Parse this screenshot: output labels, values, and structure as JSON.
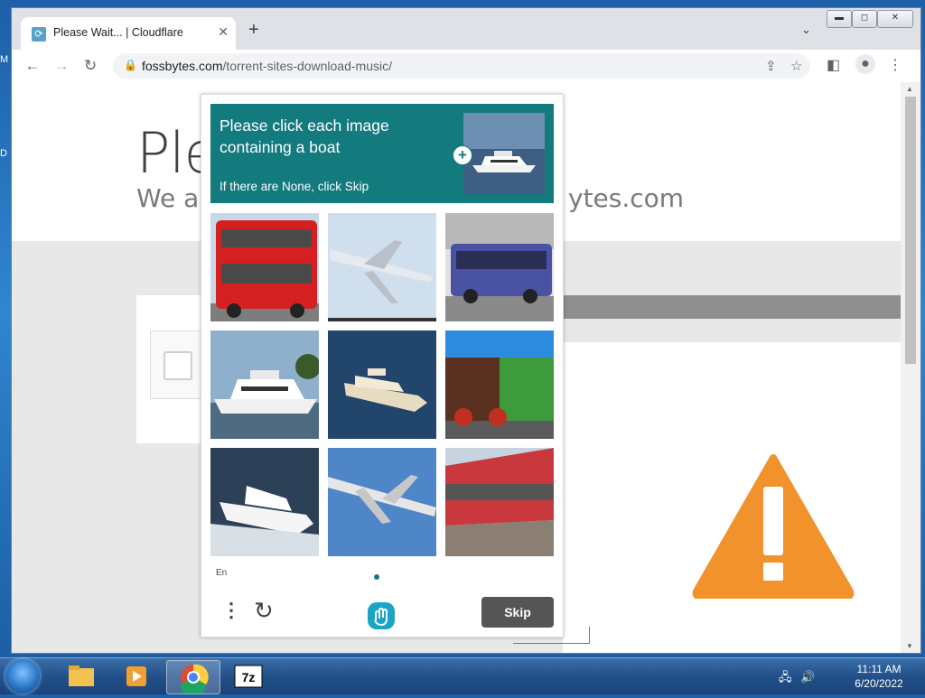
{
  "browser": {
    "tab_title": "Please Wait... | Cloudflare",
    "url_host": "fossbytes.com",
    "url_path": "/torrent-sites-download-music/"
  },
  "page": {
    "heading": "Ple",
    "subheading": "We ar",
    "subheading_right": "ytes.com"
  },
  "captcha": {
    "prompt_line1": "Please click each image containing a boat",
    "prompt_hint": "If there are None, click Skip",
    "language": "En",
    "skip_label": "Skip",
    "images": [
      {
        "id": "bus-red",
        "subject": "red double-decker bus"
      },
      {
        "id": "airplane-1",
        "subject": "airplane"
      },
      {
        "id": "bus-blue",
        "subject": "blue bus"
      },
      {
        "id": "boat-1",
        "subject": "motor yacht"
      },
      {
        "id": "boat-2",
        "subject": "motor yacht"
      },
      {
        "id": "train-steam",
        "subject": "steam locomotive"
      },
      {
        "id": "boat-3",
        "subject": "speed boat"
      },
      {
        "id": "airplane-2",
        "subject": "airplane"
      },
      {
        "id": "train-red",
        "subject": "red train"
      }
    ]
  },
  "taskbar": {
    "apps": [
      "file-explorer",
      "media-player",
      "chrome",
      "7-zip"
    ],
    "active_app": "chrome",
    "time": "11:11 AM",
    "date": "6/20/2022"
  },
  "desktop": {
    "edge_letters": [
      "M",
      "D"
    ]
  }
}
